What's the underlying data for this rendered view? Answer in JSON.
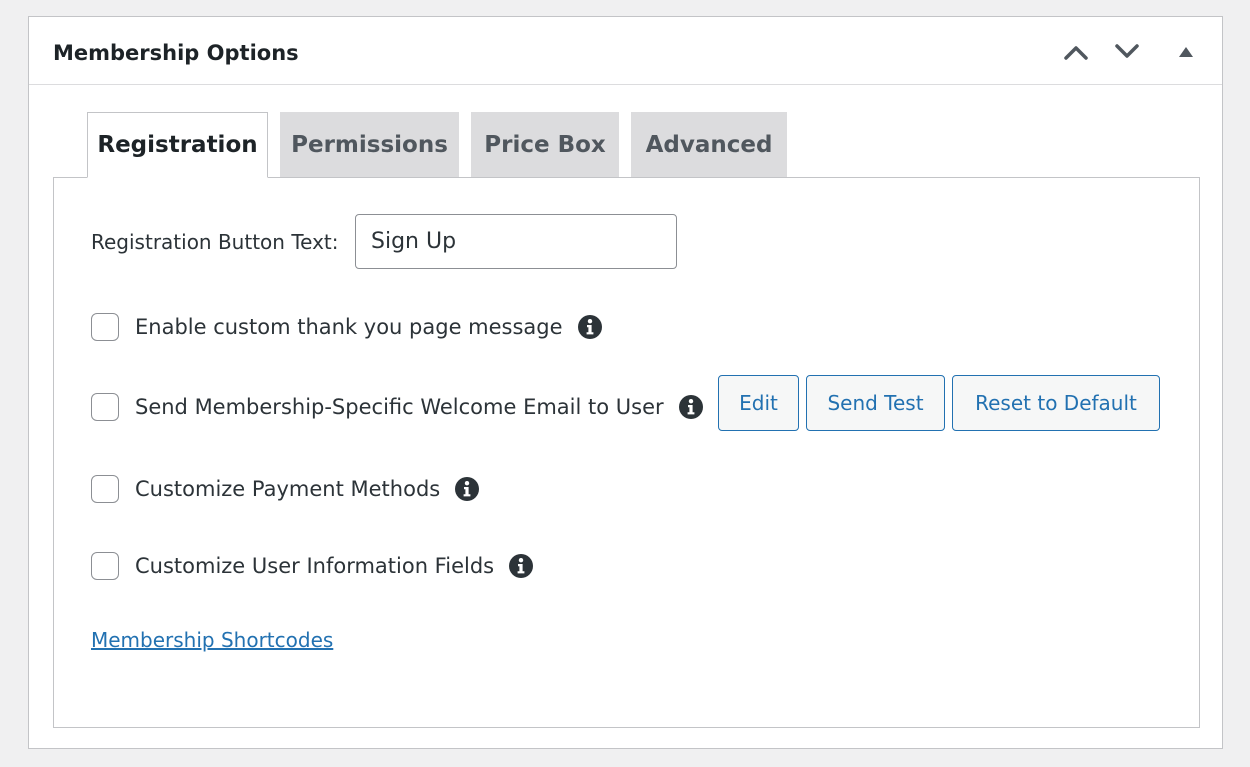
{
  "panel": {
    "title": "Membership Options",
    "controls": [
      {
        "name": "move-up",
        "icon": "chevron-up-icon"
      },
      {
        "name": "move-down",
        "icon": "chevron-down-icon"
      },
      {
        "name": "toggle-panel",
        "icon": "triangle-up-icon"
      }
    ]
  },
  "tabs": [
    {
      "label": "Registration",
      "active": true
    },
    {
      "label": "Permissions",
      "active": false
    },
    {
      "label": "Price Box",
      "active": false
    },
    {
      "label": "Advanced",
      "active": false
    }
  ],
  "registration": {
    "button_text_label": "Registration Button Text:",
    "button_text_value": "Sign Up",
    "options": [
      {
        "label": "Enable custom thank you page message",
        "checked": false,
        "icon": "info-icon"
      },
      {
        "label": "Send Membership-Specific Welcome Email to User",
        "checked": false,
        "icon": "info-icon"
      },
      {
        "label": "Customize Payment Methods",
        "checked": false,
        "icon": "info-icon"
      },
      {
        "label": "Customize User Information Fields",
        "checked": false,
        "icon": "info-icon"
      }
    ],
    "email_buttons": {
      "edit": "Edit",
      "send_test": "Send Test",
      "reset": "Reset to Default"
    },
    "shortcodes_link": "Membership Shortcodes"
  },
  "colors": {
    "accent": "#2271b1",
    "tab_inactive_bg": "#dcdcde",
    "page_bg": "#f0f0f1"
  }
}
